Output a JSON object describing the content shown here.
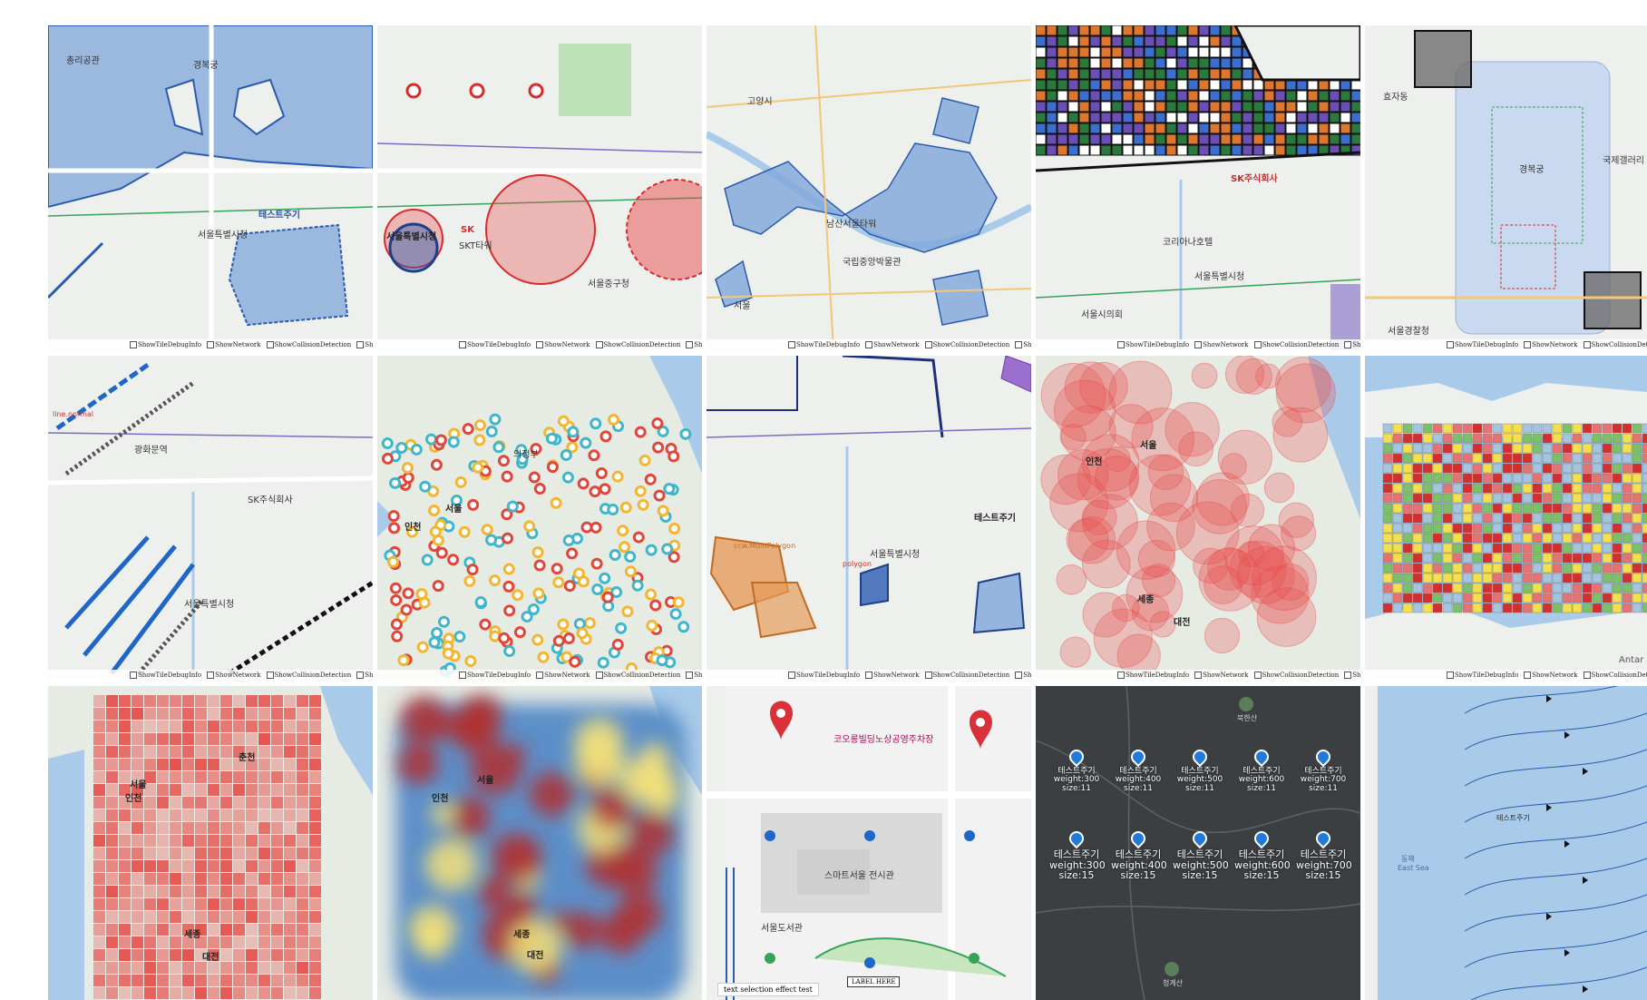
{
  "debug_options": [
    "ShowTileDebugInfo",
    "ShowNetwork",
    "ShowCollisionDetection",
    "ShowPoiVertex"
  ],
  "tiles": [
    {
      "labels": [
        "테스트주기",
        "서울특별시청",
        "경복궁",
        "총리공관"
      ]
    },
    {
      "labels": [
        "서울특별시청",
        "서울중구청",
        "SK",
        "SKT타워"
      ]
    },
    {
      "labels": [
        "남산서울타워",
        "고양시",
        "국립중앙박물관",
        "서울"
      ]
    },
    {
      "labels": [
        "서울특별시청",
        "SK주식회사",
        "코리아나호텔",
        "서울시의회"
      ]
    },
    {
      "labels": [
        "경복궁",
        "국제갤러리",
        "서울경찰청",
        "효자동"
      ]
    },
    {
      "labels": [
        "광화문역",
        "서울특별시청",
        "SK주식회사",
        "line.normal"
      ]
    },
    {
      "labels": [
        "인천",
        "서울",
        "의정부"
      ]
    },
    {
      "labels": [
        "테스트주기",
        "서울특별시청",
        "ccw.MultiPolygon",
        "polygon"
      ]
    },
    {
      "labels": [
        "서울",
        "인천",
        "세종",
        "대전"
      ]
    },
    {
      "labels": [
        "Antar"
      ]
    },
    {
      "labels": [
        "서울",
        "인천",
        "세종",
        "대전",
        "춘천"
      ]
    },
    {
      "labels": [
        "서울",
        "인천",
        "세종",
        "대전"
      ]
    },
    {
      "labels": [
        "코오롱빌딩노상공영주차장",
        "스마트서울 전시관",
        "서울도서관"
      ],
      "selection_text": "text selection effect test",
      "label_here": "LABEL HERE"
    },
    {
      "labels": [
        "북한산",
        "청계산"
      ],
      "markers": [
        {
          "title": "테스트주기",
          "weight": "weight:300",
          "size": "size:11"
        },
        {
          "title": "테스트주기",
          "weight": "weight:400",
          "size": "size:11"
        },
        {
          "title": "테스트주기",
          "weight": "weight:500",
          "size": "size:11"
        },
        {
          "title": "테스트주기",
          "weight": "weight:600",
          "size": "size:11"
        },
        {
          "title": "테스트주기",
          "weight": "weight:700",
          "size": "size:11"
        },
        {
          "title": "테스트주기",
          "weight": "weight:300",
          "size": "size:15"
        },
        {
          "title": "테스트주기",
          "weight": "weight:400",
          "size": "size:15"
        },
        {
          "title": "테스트주기",
          "weight": "weight:500",
          "size": "size:15"
        },
        {
          "title": "테스트주기",
          "weight": "weight:600",
          "size": "size:15"
        },
        {
          "title": "테스트주기",
          "weight": "weight:700",
          "size": "size:15"
        }
      ]
    },
    {
      "labels": [
        "동해",
        "East Sea",
        "테스트주기"
      ]
    }
  ],
  "colors": {
    "land": "#eef0ee",
    "water": "#a9cbe9",
    "blue_fill": "#7fa6d9",
    "red_fill": "#e84a4a",
    "dark_bg": "#3b3f42"
  }
}
